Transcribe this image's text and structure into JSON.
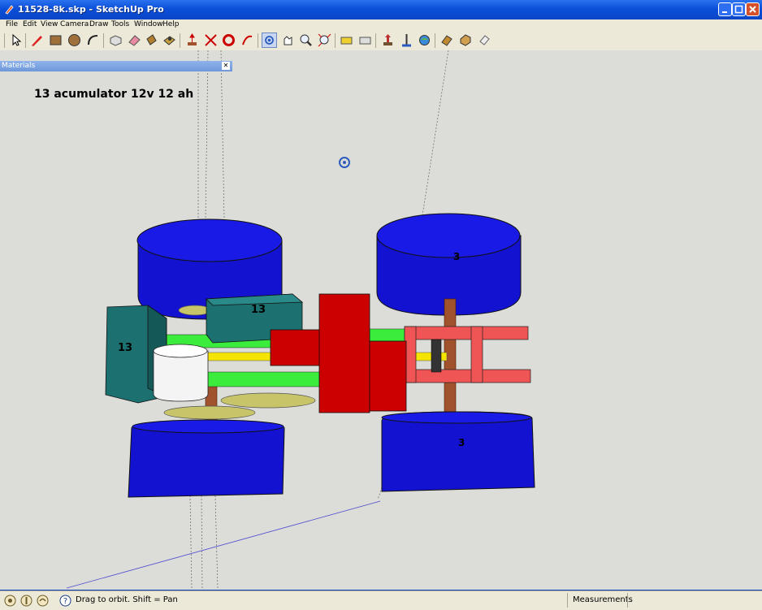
{
  "window": {
    "title": "11528-8k.skp - SketchUp Pro",
    "controls": [
      "minimize-icon",
      "maximize-icon",
      "close-icon"
    ]
  },
  "menu": [
    "File",
    "Edit",
    "View",
    "Camera",
    "Draw",
    "Tools",
    "Window",
    "Help"
  ],
  "toolbar": {
    "tools": [
      "select-icon",
      "pencil-icon",
      "rectangle-icon",
      "circle-icon",
      "arc-icon",
      "make-component-icon",
      "eraser-icon",
      "paint-bucket-icon",
      "push-pull-icon",
      "move-icon",
      "rotate-icon",
      "follow-me-icon",
      "offset-icon",
      "orbit-icon",
      "pan-icon",
      "zoom-icon",
      "zoom-extents-icon",
      "tape-measure-icon",
      "dimension-icon",
      "walk-icon",
      "look-around-icon",
      "position-camera-icon",
      "section-plane-icon",
      "components-icon",
      "shadows-icon",
      "get-models-icon"
    ],
    "active_tool": "orbit-icon"
  },
  "materials_panel": {
    "title": "Materials"
  },
  "annotation": "13 acumulator 12v 12 ah",
  "model_labels": {
    "battery_top": "13",
    "battery_left": "13",
    "wheel_back_right": "3",
    "wheel_front_right": "3"
  },
  "status": {
    "hint": "Drag to orbit.  Shift = Pan",
    "measurements_label": "Measurements",
    "measurements_value": ""
  },
  "colors": {
    "wheel": "#1414d8",
    "battery": "#1a6e6e",
    "motor": "#c00000",
    "frame_red": "#f05050",
    "frame_green": "#33ee33",
    "axle": "#f0e000",
    "disc": "#c7c36b",
    "shaft": "#8b4513",
    "background": "#dcdcd8"
  }
}
